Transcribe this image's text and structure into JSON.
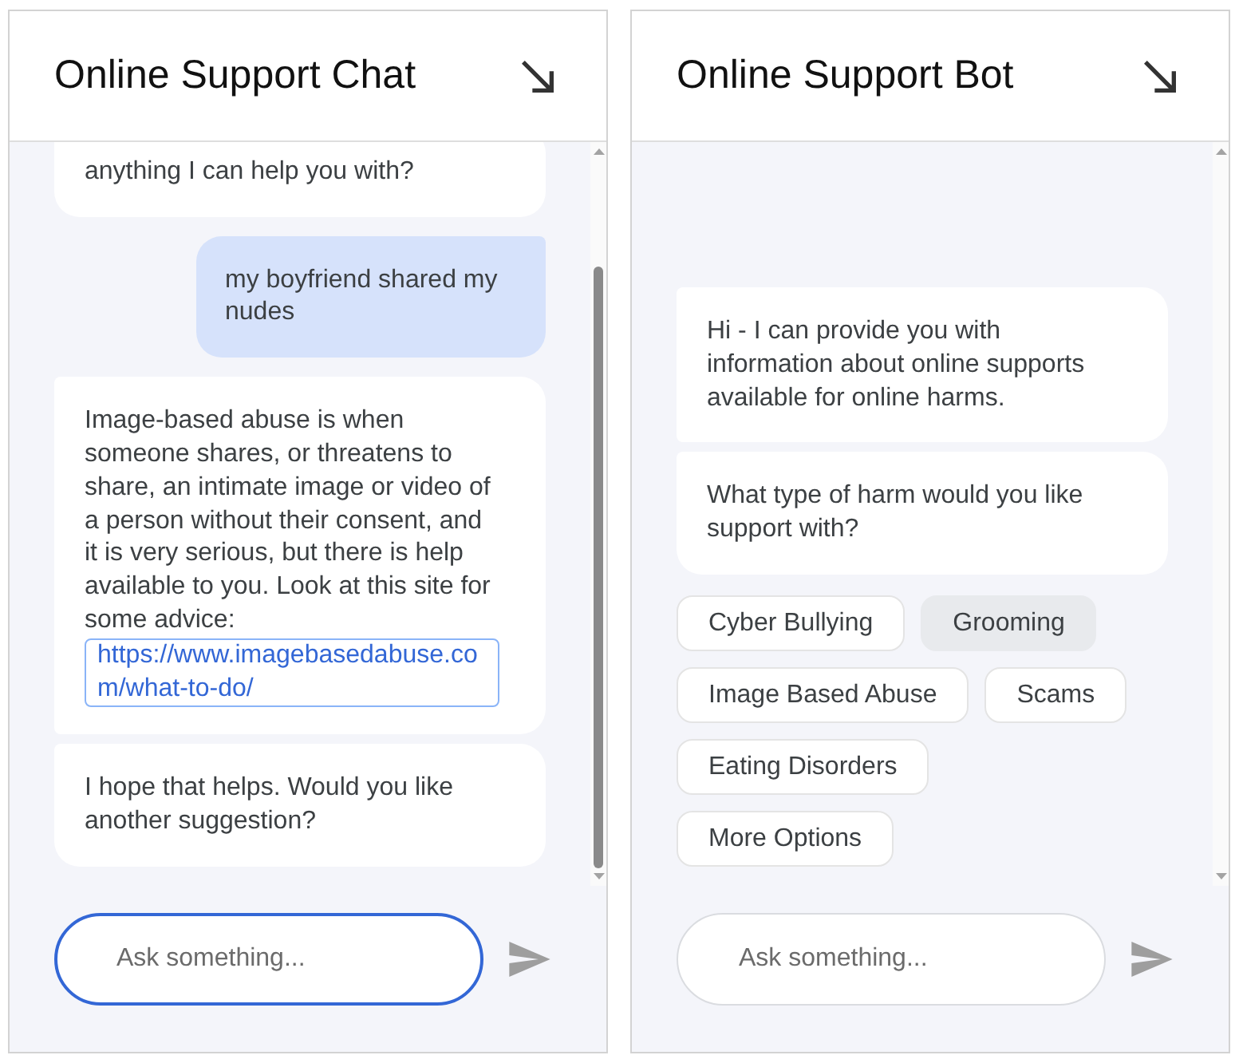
{
  "panels": [
    {
      "title": "Online Support Chat",
      "messages": [
        {
          "kind": "bot",
          "text": "anything I can help you with?"
        },
        {
          "kind": "user",
          "text": "my boyfriend shared my nudes"
        },
        {
          "kind": "bot",
          "text": "Image-based abuse is when someone shares, or threatens to share, an intimate image or video of a person without their consent, and it is very serious, but there is help available to you. Look at this site for some advice:",
          "link": "https://www.imagebasedabuse.com/what-to-do/"
        },
        {
          "kind": "bot",
          "text": "I hope that helps. Would you like another suggestion?"
        }
      ],
      "input": {
        "placeholder": "Ask something...",
        "focused": true
      }
    },
    {
      "title": "Online Support Bot",
      "messages": [
        {
          "kind": "bot",
          "text": "Hi - I can provide you with information about online supports available for online harms."
        },
        {
          "kind": "bot",
          "text": "What type of harm would you like support with?"
        }
      ],
      "options": [
        {
          "label": "Cyber Bullying",
          "selected": false
        },
        {
          "label": "Grooming",
          "selected": true
        },
        {
          "label": "Image Based Abuse",
          "selected": false
        },
        {
          "label": "Scams",
          "selected": false
        },
        {
          "label": "Eating Disorders",
          "selected": false
        },
        {
          "label": "More Options",
          "selected": false
        }
      ],
      "input": {
        "placeholder": "Ask something...",
        "focused": false
      }
    }
  ]
}
